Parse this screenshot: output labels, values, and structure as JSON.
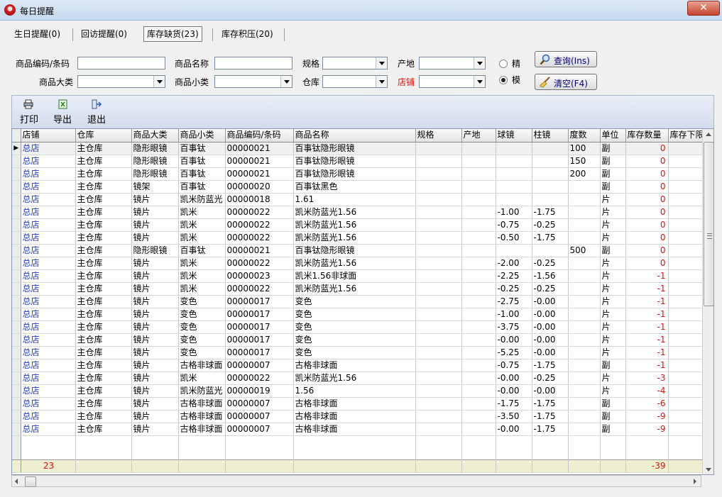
{
  "window": {
    "title": "每日提醒",
    "close_label": "✕"
  },
  "tabs": [
    "生日提醒(0)",
    "回访提醒(0)",
    "库存缺货(23)",
    "库存积压(20)"
  ],
  "filters": {
    "code_label": "商品编码/条码",
    "name_label": "商品名称",
    "spec_label": "规格",
    "origin_label": "产地",
    "category_label": "商品大类",
    "subcategory_label": "商品小类",
    "warehouse_label": "仓库",
    "store_label": "店铺",
    "exact_label": "精",
    "fuzzy_label": "模",
    "match_mode": "模"
  },
  "buttons": {
    "query": "查询(Ins)",
    "clear": "清空(F4)"
  },
  "toolbar": {
    "print": "打印",
    "export": "导出",
    "exit": "退出"
  },
  "table": {
    "headers": [
      "店铺",
      "仓库",
      "商品大类",
      "商品小类",
      "商品编码/条码",
      "商品名称",
      "规格",
      "产地",
      "球镜",
      "柱镜",
      "度数",
      "单位",
      "库存数量",
      "库存下限"
    ],
    "rows": [
      [
        "总店",
        "主仓库",
        "隐形眼镜",
        "百事钛",
        "00000021",
        "百事钛隐形眼镜",
        "",
        "",
        "",
        "",
        "100",
        "副",
        "0"
      ],
      [
        "总店",
        "主仓库",
        "隐形眼镜",
        "百事钛",
        "00000021",
        "百事钛隐形眼镜",
        "",
        "",
        "",
        "",
        "150",
        "副",
        "0"
      ],
      [
        "总店",
        "主仓库",
        "隐形眼镜",
        "百事钛",
        "00000021",
        "百事钛隐形眼镜",
        "",
        "",
        "",
        "",
        "200",
        "副",
        "0"
      ],
      [
        "总店",
        "主仓库",
        "镜架",
        "百事钛",
        "00000020",
        "百事钛黑色",
        "",
        "",
        "",
        "",
        "",
        "副",
        "0"
      ],
      [
        "总店",
        "主仓库",
        "镜片",
        "凯米防蓝光",
        "00000018",
        "1.61",
        "",
        "",
        "",
        "",
        "",
        "片",
        "0"
      ],
      [
        "总店",
        "主仓库",
        "镜片",
        "凯米",
        "00000022",
        "凯米防蓝光1.56",
        "",
        "",
        "-1.00",
        "-1.75",
        "",
        "片",
        "0"
      ],
      [
        "总店",
        "主仓库",
        "镜片",
        "凯米",
        "00000022",
        "凯米防蓝光1.56",
        "",
        "",
        "-0.75",
        "-0.25",
        "",
        "片",
        "0"
      ],
      [
        "总店",
        "主仓库",
        "镜片",
        "凯米",
        "00000022",
        "凯米防蓝光1.56",
        "",
        "",
        "-0.50",
        "-1.75",
        "",
        "片",
        "0"
      ],
      [
        "总店",
        "主仓库",
        "隐形眼镜",
        "百事钛",
        "00000021",
        "百事钛隐形眼镜",
        "",
        "",
        "",
        "",
        "500",
        "副",
        "0"
      ],
      [
        "总店",
        "主仓库",
        "镜片",
        "凯米",
        "00000022",
        "凯米防蓝光1.56",
        "",
        "",
        "-2.00",
        "-0.25",
        "",
        "片",
        "0"
      ],
      [
        "总店",
        "主仓库",
        "镜片",
        "凯米",
        "00000023",
        "凯米1.56非球面",
        "",
        "",
        "-2.25",
        "-1.56",
        "",
        "片",
        "-1"
      ],
      [
        "总店",
        "主仓库",
        "镜片",
        "凯米",
        "00000022",
        "凯米防蓝光1.56",
        "",
        "",
        "-0.25",
        "-0.25",
        "",
        "片",
        "-1"
      ],
      [
        "总店",
        "主仓库",
        "镜片",
        "变色",
        "00000017",
        "变色",
        "",
        "",
        "-2.75",
        "-0.00",
        "",
        "片",
        "-1"
      ],
      [
        "总店",
        "主仓库",
        "镜片",
        "变色",
        "00000017",
        "变色",
        "",
        "",
        "-1.00",
        "-0.00",
        "",
        "片",
        "-1"
      ],
      [
        "总店",
        "主仓库",
        "镜片",
        "变色",
        "00000017",
        "变色",
        "",
        "",
        "-3.75",
        "-0.00",
        "",
        "片",
        "-1"
      ],
      [
        "总店",
        "主仓库",
        "镜片",
        "变色",
        "00000017",
        "变色",
        "",
        "",
        "-0.00",
        "-0.00",
        "",
        "片",
        "-1"
      ],
      [
        "总店",
        "主仓库",
        "镜片",
        "变色",
        "00000017",
        "变色",
        "",
        "",
        "-5.25",
        "-0.00",
        "",
        "片",
        "-1"
      ],
      [
        "总店",
        "主仓库",
        "镜片",
        "古格非球面",
        "00000007",
        "古格非球面",
        "",
        "",
        "-0.75",
        "-1.75",
        "",
        "副",
        "-1"
      ],
      [
        "总店",
        "主仓库",
        "镜片",
        "凯米",
        "00000022",
        "凯米防蓝光1.56",
        "",
        "",
        "-0.00",
        "-0.25",
        "",
        "片",
        "-3"
      ],
      [
        "总店",
        "主仓库",
        "镜片",
        "凯米防蓝光",
        "00000019",
        "1.56",
        "",
        "",
        "-0.00",
        "-0.00",
        "",
        "片",
        "-4"
      ],
      [
        "总店",
        "主仓库",
        "镜片",
        "古格非球面",
        "00000007",
        "古格非球面",
        "",
        "",
        "-1.75",
        "-1.75",
        "",
        "副",
        "-6"
      ],
      [
        "总店",
        "主仓库",
        "镜片",
        "古格非球面",
        "00000007",
        "古格非球面",
        "",
        "",
        "-3.50",
        "-1.75",
        "",
        "副",
        "-9"
      ],
      [
        "总店",
        "主仓库",
        "镜片",
        "古格非球面",
        "00000007",
        "古格非球面",
        "",
        "",
        "-0.00",
        "-1.75",
        "",
        "副",
        "-9"
      ]
    ],
    "footer": {
      "count": "23",
      "total_qty": "-39"
    }
  }
}
